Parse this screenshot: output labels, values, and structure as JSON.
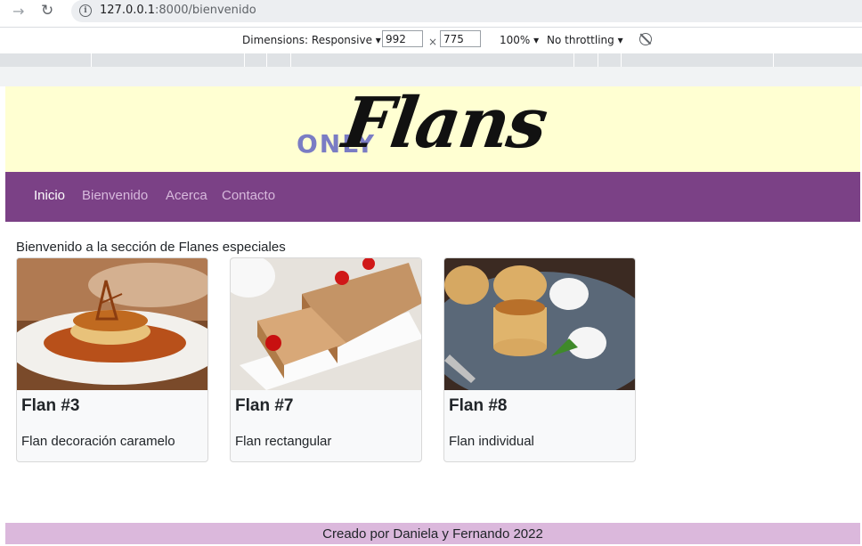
{
  "browser": {
    "url_host": "127.0.0.1",
    "url_path": ":8000/bienvenido"
  },
  "devtools": {
    "dimensions_label": "Dimensions: Responsive",
    "width_value": "992",
    "times": "×",
    "height_value": "775",
    "zoom": "100%",
    "throttling": "No throttling"
  },
  "site": {
    "logo_only": "ONLY",
    "logo_flans": "Flans"
  },
  "nav": {
    "items": [
      {
        "label": "Inicio",
        "active": true
      },
      {
        "label": "Bienvenido",
        "active": false
      },
      {
        "label": "Acerca",
        "active": false
      },
      {
        "label": "Contacto",
        "active": false
      }
    ]
  },
  "main": {
    "intro": "Bienvenido a la sección de Flanes especiales",
    "cards": [
      {
        "title": "Flan #3",
        "description": "Flan decoración caramelo"
      },
      {
        "title": "Flan #7",
        "description": "Flan rectangular"
      },
      {
        "title": "Flan #8",
        "description": "Flan individual"
      }
    ]
  },
  "footer": {
    "text": "Creado por Daniela y Fernando 2022"
  },
  "colors": {
    "header_bg": "#ffffd2",
    "navbar_bg": "#7b4186",
    "footer_bg": "#dbb8dc",
    "logo_accent": "#7a7cc4"
  }
}
